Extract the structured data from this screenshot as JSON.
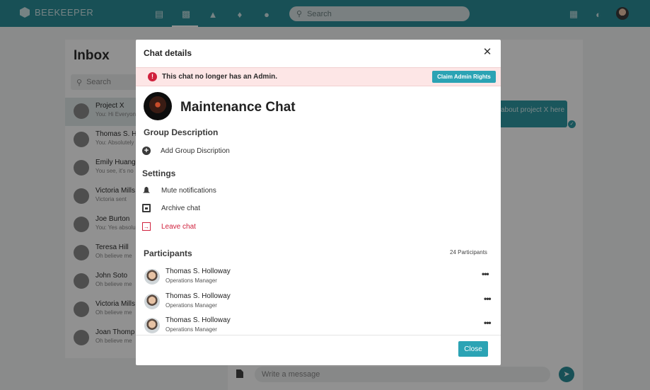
{
  "app": {
    "brand": "BEEKEEPER"
  },
  "topbar": {
    "search_placeholder": "Search",
    "nav_icons": [
      "news-icon",
      "chat-icon",
      "home-icon",
      "bell-icon",
      "people-icon"
    ],
    "right_icons": [
      "calendar-icon",
      "gauge-icon",
      "avatar"
    ]
  },
  "inbox": {
    "title": "Inbox",
    "search_placeholder": "Search",
    "conversations": [
      {
        "name": "Project X",
        "preview": "You: Hi Everyone"
      },
      {
        "name": "Thomas S. H",
        "preview": "You: Absolutely"
      },
      {
        "name": "Emily Huang",
        "preview": "You see, it's no"
      },
      {
        "name": "Victoria Mills",
        "preview": "Victoria sent"
      },
      {
        "name": "Joe Burton",
        "preview": "You: Yes absolu"
      },
      {
        "name": "Teresa Hill",
        "preview": "Oh believe me"
      },
      {
        "name": "John Soto",
        "preview": "Oh believe me"
      },
      {
        "name": "Victoria Mills",
        "preview": "Oh believe me"
      },
      {
        "name": "Joan Thomp",
        "preview": "Oh believe me"
      }
    ]
  },
  "chat": {
    "bubble_text": "about project X here",
    "composer_placeholder": "Write a message"
  },
  "modal": {
    "title": "Chat details",
    "alert_text": "This chat no longer has an Admin.",
    "claim_label": "Claim Admin Rights",
    "group_name": "Maintenance Chat",
    "group_description_title": "Group Description",
    "add_description_label": "Add Group Discription",
    "settings_title": "Settings",
    "settings": {
      "mute": "Mute notifications",
      "archive": "Archive chat",
      "leave": "Leave chat"
    },
    "participants_title": "Participants",
    "participants_count": "24 Participants",
    "participants": [
      {
        "name": "Thomas S. Holloway",
        "role": "Operations Manager"
      },
      {
        "name": "Thomas S. Holloway",
        "role": "Operations Manager"
      },
      {
        "name": "Thomas S. Holloway",
        "role": "Operations Manager"
      }
    ],
    "more_label": "•••",
    "close_label": "Close",
    "alert_color": "#d0213d",
    "accent_color": "#2ba3b4"
  }
}
